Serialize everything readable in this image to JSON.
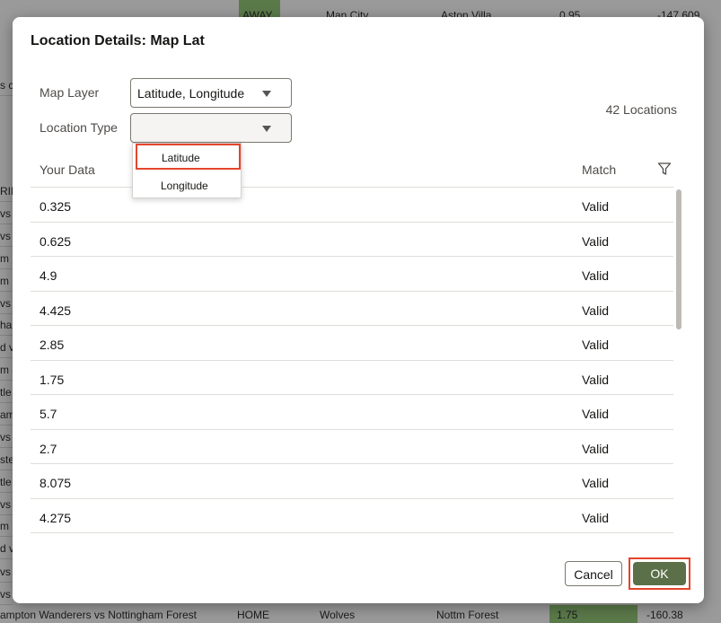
{
  "background": {
    "top_cells": [
      "AWAY",
      "Man City",
      "Aston Villa",
      "0.95",
      "-147.609"
    ],
    "bottom_row": [
      "ampton Wanderers vs Nottingham Forest",
      "HOME",
      "Wolves",
      "Nottm Forest",
      "1.75",
      "-160.38"
    ],
    "left_cut": [
      "s c",
      "RIF",
      "vs",
      "vs",
      "m",
      "m",
      "vs",
      "ha",
      "d v",
      "m &",
      "tle",
      "am",
      "vs",
      "ste",
      "tle",
      "vs",
      "m",
      "d v",
      "vs",
      "vs"
    ]
  },
  "dialog": {
    "title": "Location Details: Map Lat",
    "map_layer_label": "Map Layer",
    "map_layer_value": "Latitude, Longitude",
    "location_type_label": "Location Type",
    "location_type_value": "",
    "locations_count": "42 Locations",
    "columns": {
      "your_data": "Your Data",
      "match": "Match"
    },
    "rows": [
      {
        "value": "0.325",
        "match": "Valid"
      },
      {
        "value": "0.625",
        "match": "Valid"
      },
      {
        "value": "4.9",
        "match": "Valid"
      },
      {
        "value": "4.425",
        "match": "Valid"
      },
      {
        "value": "2.85",
        "match": "Valid"
      },
      {
        "value": "1.75",
        "match": "Valid"
      },
      {
        "value": "5.7",
        "match": "Valid"
      },
      {
        "value": "2.7",
        "match": "Valid"
      },
      {
        "value": "8.075",
        "match": "Valid"
      },
      {
        "value": "4.275",
        "match": "Valid"
      }
    ],
    "dropdown_options": [
      "Latitude",
      "Longitude"
    ],
    "cancel_label": "Cancel",
    "ok_label": "OK"
  },
  "colors": {
    "ok_button": "#5b7048",
    "highlight_outline": "#e4452c"
  },
  "icons": {
    "filter": "filter-icon",
    "caret": "chevron-down-icon"
  }
}
